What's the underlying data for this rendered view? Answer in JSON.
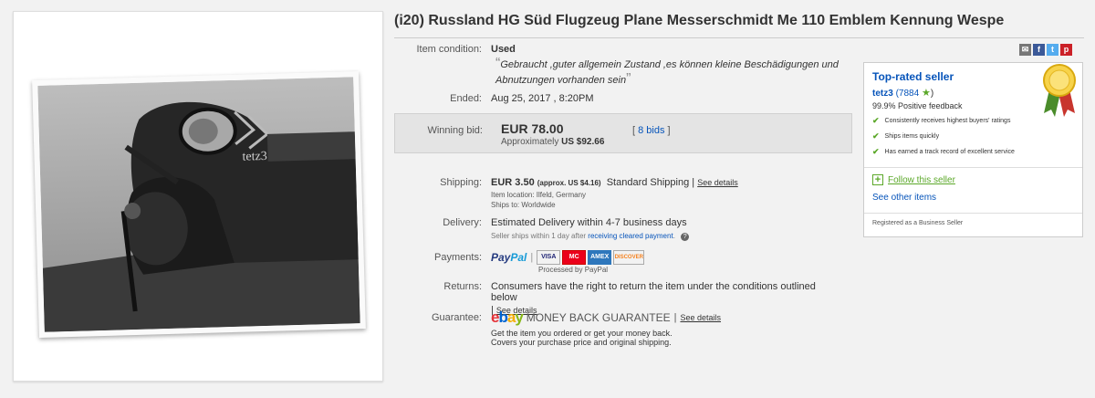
{
  "item": {
    "title": "(i20) Russland HG Süd Flugzeug Plane Messerschmidt Me 110 Emblem Kennung Wespe",
    "photo_watermark": "tetz3"
  },
  "condition": {
    "label": "Item condition:",
    "value": "Used",
    "quote": "Gebraucht ,guter allgemein Zustand ,es können kleine Beschädigungen und Abnutzungen vorhanden sein"
  },
  "ended": {
    "label": "Ended:",
    "value": "Aug 25, 2017 , 8:20PM"
  },
  "bid": {
    "label": "Winning bid:",
    "amount": "EUR 78.00",
    "approx_label": "Approximately",
    "approx_value": "US $92.66",
    "bids_open": "[",
    "bids_link": "8 bids",
    "bids_close": "]"
  },
  "shipping": {
    "label": "Shipping:",
    "cost": "EUR 3.50",
    "approx": "(approx. US $4.16)",
    "method": "Standard Shipping",
    "sep": "|",
    "see_details": "See details",
    "location": "Item location:  Ilfeld, Germany",
    "ships_to": "Ships to:  Worldwide"
  },
  "delivery": {
    "label": "Delivery:",
    "value": "Estimated Delivery within 4-7 business days",
    "note_prefix": "Seller ships within 1 day after",
    "note_link": "receiving cleared payment",
    "note_suffix": "."
  },
  "payments": {
    "label": "Payments:",
    "paypal_a": "Pay",
    "paypal_b": "Pal",
    "cards": [
      "VISA",
      "MC",
      "AMEX",
      "DISCOVER"
    ],
    "processed": "Processed by PayPal"
  },
  "returns": {
    "label": "Returns:",
    "value": "Consumers have the right to return the item under the conditions outlined below",
    "see_details": "See details"
  },
  "guarantee": {
    "label": "Guarantee:",
    "logo": [
      "e",
      "b",
      "a",
      "y"
    ],
    "mbg": "MONEY BACK GUARANTEE",
    "see_details": "See details",
    "line1": "Get the item you ordered or get your money back.",
    "line2": "Covers your purchase price and original shipping."
  },
  "share_icons": [
    "email-icon",
    "facebook-icon",
    "twitter-icon",
    "pinterest-icon"
  ],
  "seller": {
    "badge": "Top-rated seller",
    "name": "tetz3",
    "score": "(7884",
    "score_close": ")",
    "feedback": "99.9% Positive feedback",
    "points": [
      "Consistently receives highest buyers' ratings",
      "Ships items quickly",
      "Has earned a track record of excellent service"
    ],
    "follow": "Follow this seller",
    "see_other": "See other items",
    "business": "Registered as a Business Seller"
  },
  "colors": {
    "link": "#0654ba",
    "check": "#5ba829",
    "bid_bg": "#e4e4e4"
  }
}
